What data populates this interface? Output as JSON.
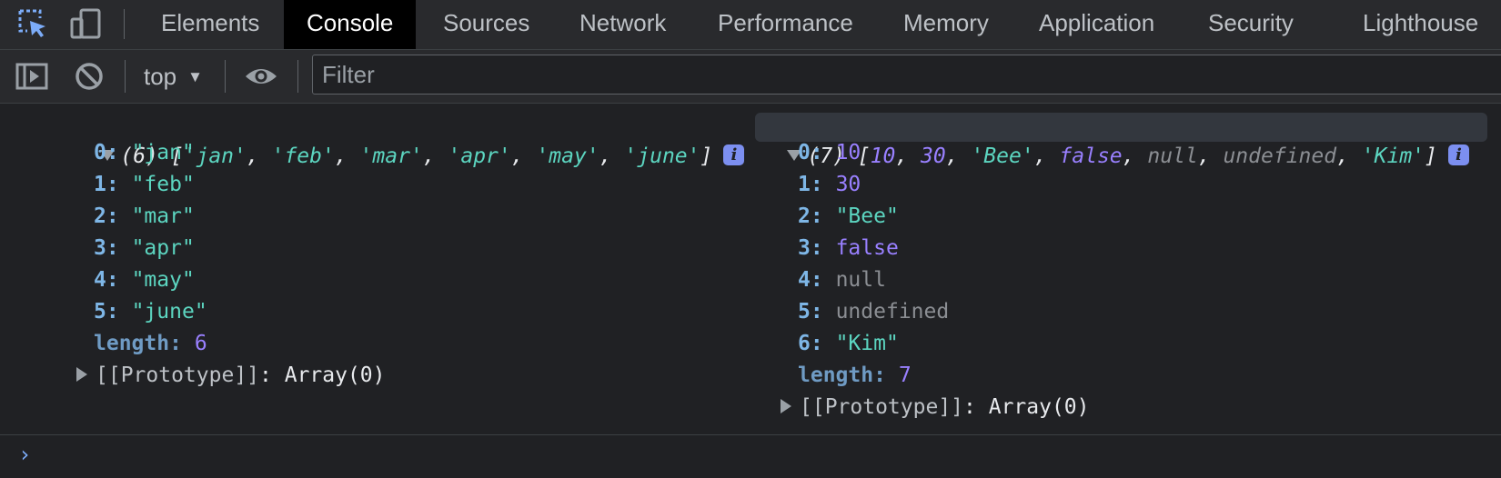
{
  "tabs": {
    "elements": "Elements",
    "console": "Console",
    "sources": "Sources",
    "network": "Network",
    "performance": "Performance",
    "memory": "Memory",
    "application": "Application",
    "security": "Security",
    "lighthouse": "Lighthouse",
    "active": "Console"
  },
  "toolbar": {
    "context": "top",
    "filter_placeholder": "Filter"
  },
  "icons": {
    "inspect": "inspect-element-icon",
    "device": "device-toolbar-icon",
    "sidebar": "show-sidebar-icon",
    "clear": "clear-console-icon",
    "eye": "live-expression-icon",
    "info": "info-icon"
  },
  "colors": {
    "background": "#202124",
    "toolbar": "#292a2d",
    "string": "#5cd5c0",
    "number": "#9980ff",
    "key": "#7eb6e6",
    "null": "#8b8e93",
    "accent": "#7cacf8"
  },
  "logs": {
    "left": {
      "count": "(6)",
      "summary": [
        "'jan'",
        "'feb'",
        "'mar'",
        "'apr'",
        "'may'",
        "'june'"
      ],
      "entries": [
        {
          "key": "0",
          "value": "\"jan\""
        },
        {
          "key": "1",
          "value": "\"feb\""
        },
        {
          "key": "2",
          "value": "\"mar\""
        },
        {
          "key": "3",
          "value": "\"apr\""
        },
        {
          "key": "4",
          "value": "\"may\""
        },
        {
          "key": "5",
          "value": "\"june\""
        }
      ],
      "length_label": "length",
      "length": "6",
      "prototype_label": "[[Prototype]]",
      "prototype_value": "Array(0)"
    },
    "right": {
      "count": "(7)",
      "summary": [
        "10",
        "30",
        "'Bee'",
        "false",
        "null",
        "undefined",
        "'Kim'"
      ],
      "entries": [
        {
          "key": "0",
          "value": "10"
        },
        {
          "key": "1",
          "value": "30"
        },
        {
          "key": "2",
          "value": "\"Bee\""
        },
        {
          "key": "3",
          "value": "false"
        },
        {
          "key": "4",
          "value": "null"
        },
        {
          "key": "5",
          "value": "undefined"
        },
        {
          "key": "6",
          "value": "\"Kim\""
        }
      ],
      "length_label": "length",
      "length": "7",
      "prototype_label": "[[Prototype]]",
      "prototype_value": "Array(0)"
    }
  },
  "prompt": "›"
}
